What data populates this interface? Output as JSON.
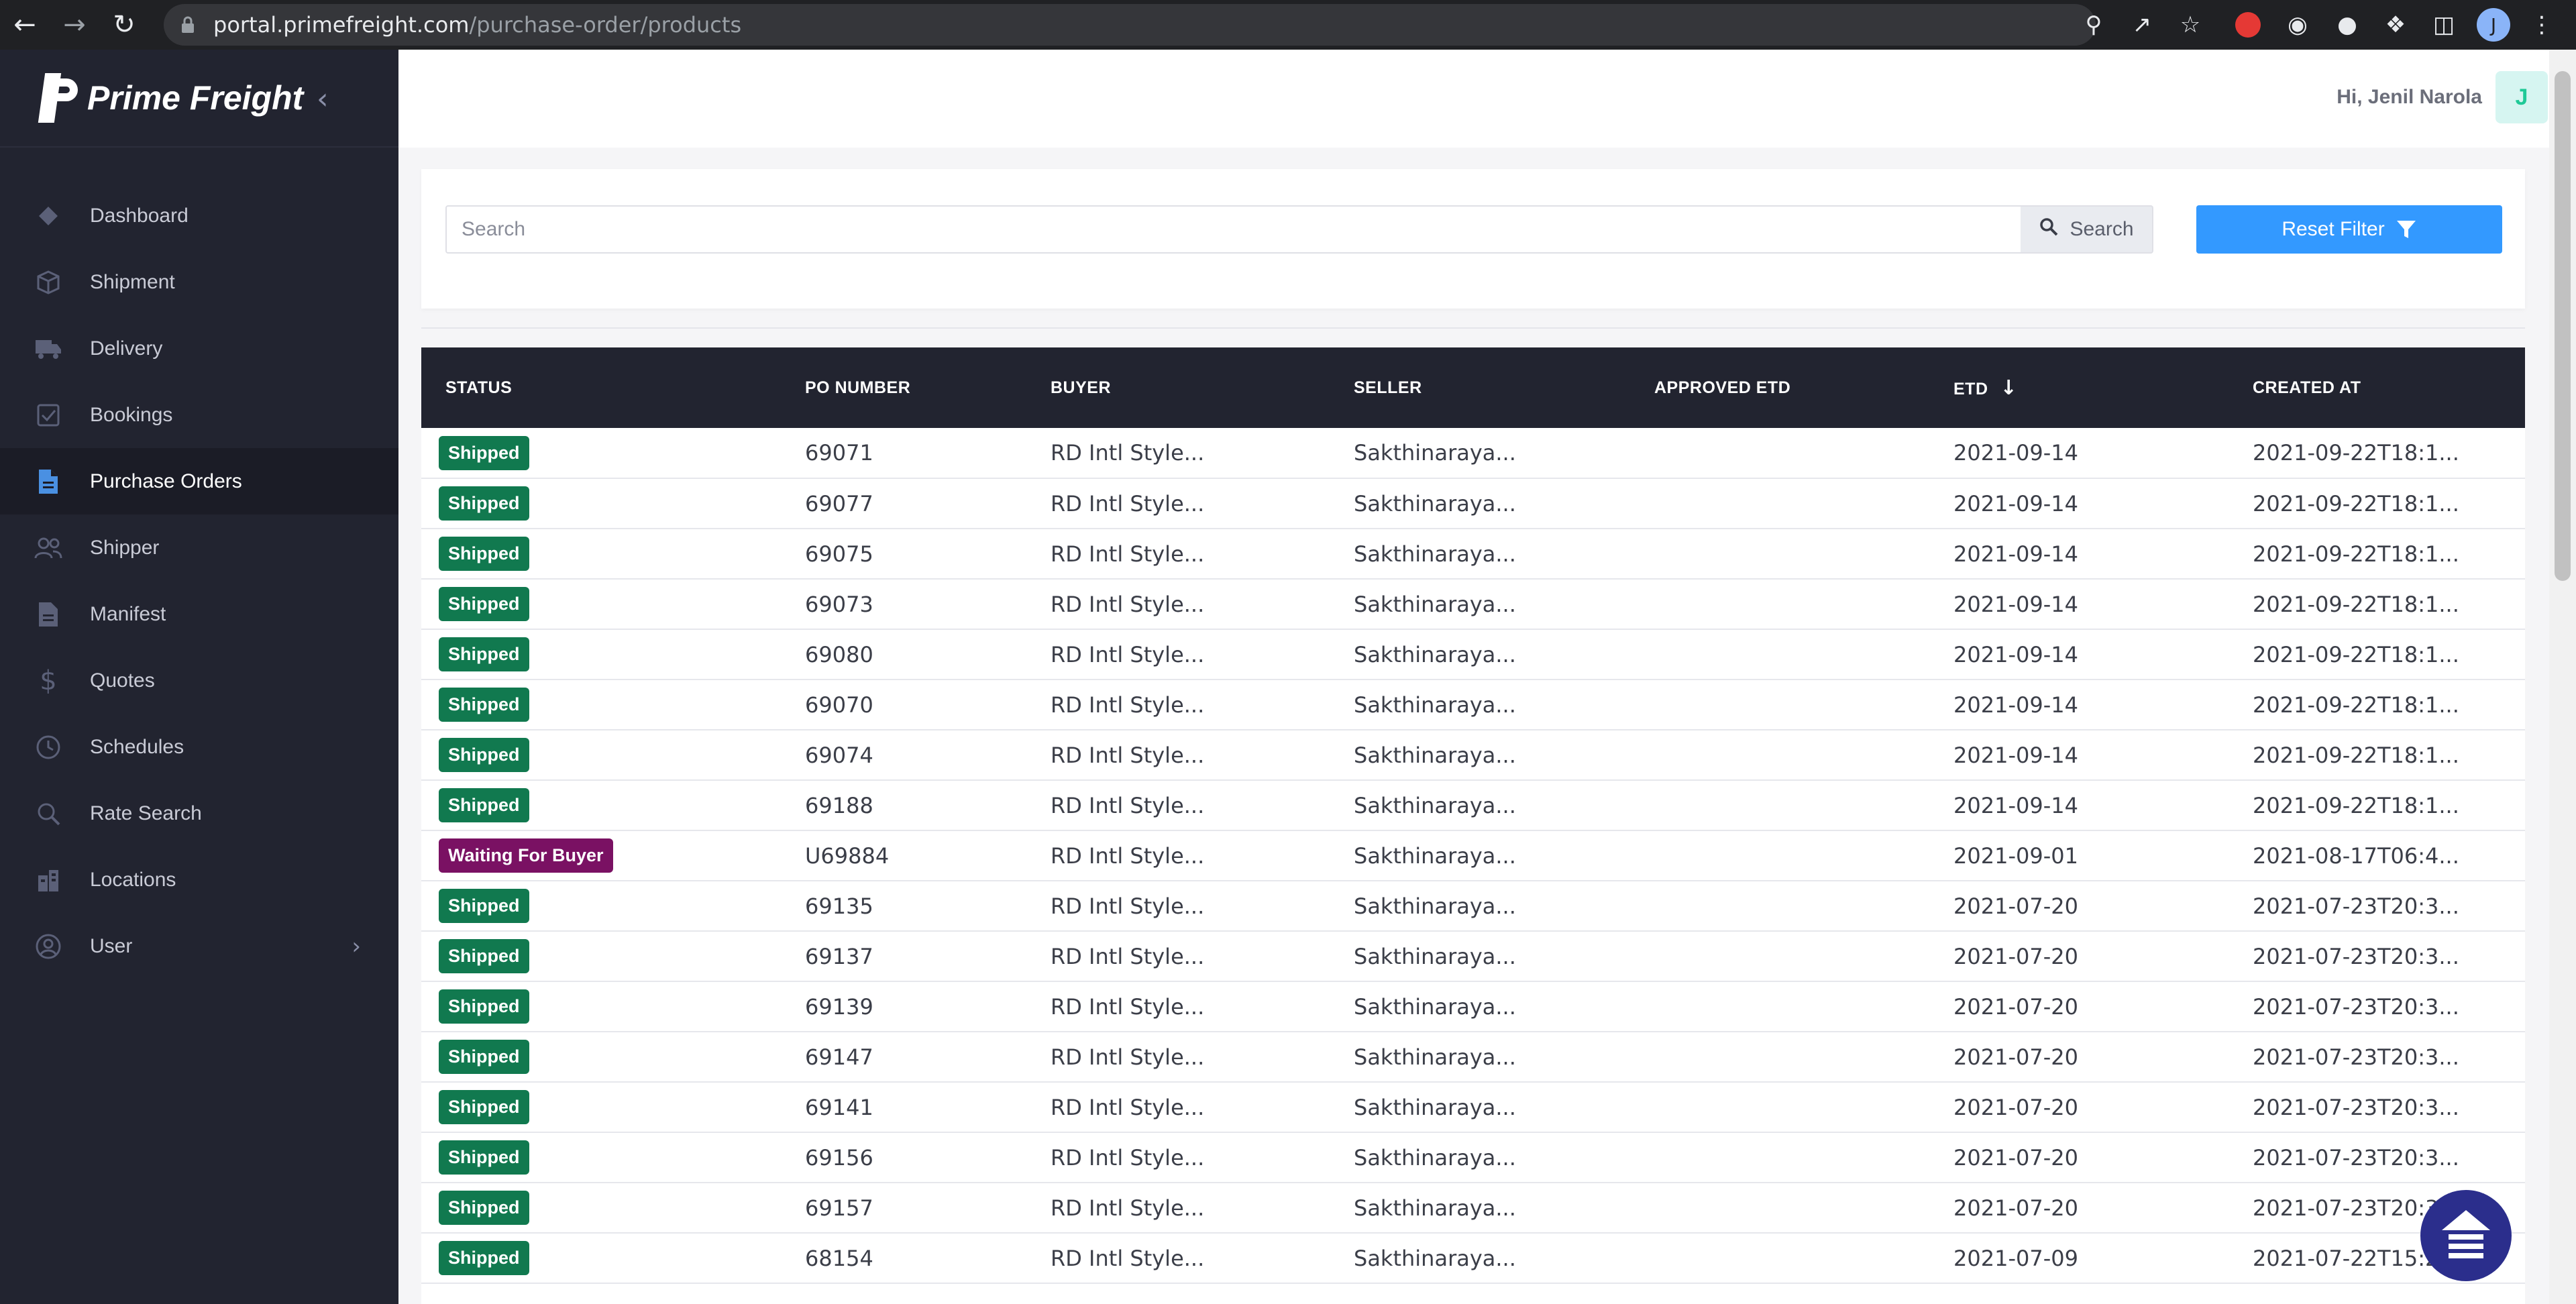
{
  "browser": {
    "url_host": "portal.primefreight.com",
    "url_path": "/purchase-order/products",
    "profile_initial": "J"
  },
  "sidebar": {
    "logo_text": "Prime Freight",
    "items": [
      {
        "label": "Dashboard",
        "icon": "diamond-icon"
      },
      {
        "label": "Shipment",
        "icon": "box-icon"
      },
      {
        "label": "Delivery",
        "icon": "truck-icon"
      },
      {
        "label": "Bookings",
        "icon": "checkbox-icon"
      },
      {
        "label": "Purchase Orders",
        "icon": "file-icon",
        "active": true
      },
      {
        "label": "Shipper",
        "icon": "users-icon"
      },
      {
        "label": "Manifest",
        "icon": "document-icon"
      },
      {
        "label": "Quotes",
        "icon": "dollar-icon"
      },
      {
        "label": "Schedules",
        "icon": "clock-icon"
      },
      {
        "label": "Rate Search",
        "icon": "search-icon"
      },
      {
        "label": "Locations",
        "icon": "building-icon"
      },
      {
        "label": "User",
        "icon": "user-circle-icon",
        "has_submenu": true
      }
    ]
  },
  "header": {
    "greeting": "Hi, Jenil Narola",
    "avatar_initial": "J"
  },
  "search": {
    "placeholder": "Search",
    "button_label": "Search",
    "reset_label": "Reset Filter"
  },
  "table": {
    "columns": [
      "STATUS",
      "PO NUMBER",
      "BUYER",
      "SELLER",
      "APPROVED ETD",
      "ETD",
      "CREATED AT"
    ],
    "sorted_column": "ETD",
    "rows": [
      {
        "status": "Shipped",
        "po": "69071",
        "buyer": "RD Intl Style...",
        "seller": "Sakthinaraya...",
        "approved_etd": "",
        "etd": "2021-09-14",
        "created": "2021-09-22T18:1..."
      },
      {
        "status": "Shipped",
        "po": "69077",
        "buyer": "RD Intl Style...",
        "seller": "Sakthinaraya...",
        "approved_etd": "",
        "etd": "2021-09-14",
        "created": "2021-09-22T18:1..."
      },
      {
        "status": "Shipped",
        "po": "69075",
        "buyer": "RD Intl Style...",
        "seller": "Sakthinaraya...",
        "approved_etd": "",
        "etd": "2021-09-14",
        "created": "2021-09-22T18:1..."
      },
      {
        "status": "Shipped",
        "po": "69073",
        "buyer": "RD Intl Style...",
        "seller": "Sakthinaraya...",
        "approved_etd": "",
        "etd": "2021-09-14",
        "created": "2021-09-22T18:1..."
      },
      {
        "status": "Shipped",
        "po": "69080",
        "buyer": "RD Intl Style...",
        "seller": "Sakthinaraya...",
        "approved_etd": "",
        "etd": "2021-09-14",
        "created": "2021-09-22T18:1..."
      },
      {
        "status": "Shipped",
        "po": "69070",
        "buyer": "RD Intl Style...",
        "seller": "Sakthinaraya...",
        "approved_etd": "",
        "etd": "2021-09-14",
        "created": "2021-09-22T18:1..."
      },
      {
        "status": "Shipped",
        "po": "69074",
        "buyer": "RD Intl Style...",
        "seller": "Sakthinaraya...",
        "approved_etd": "",
        "etd": "2021-09-14",
        "created": "2021-09-22T18:1..."
      },
      {
        "status": "Shipped",
        "po": "69188",
        "buyer": "RD Intl Style...",
        "seller": "Sakthinaraya...",
        "approved_etd": "",
        "etd": "2021-09-14",
        "created": "2021-09-22T18:1..."
      },
      {
        "status": "Waiting For Buyer",
        "po": "U69884",
        "buyer": "RD Intl Style...",
        "seller": "Sakthinaraya...",
        "approved_etd": "",
        "etd": "2021-09-01",
        "created": "2021-08-17T06:4..."
      },
      {
        "status": "Shipped",
        "po": "69135",
        "buyer": "RD Intl Style...",
        "seller": "Sakthinaraya...",
        "approved_etd": "",
        "etd": "2021-07-20",
        "created": "2021-07-23T20:3..."
      },
      {
        "status": "Shipped",
        "po": "69137",
        "buyer": "RD Intl Style...",
        "seller": "Sakthinaraya...",
        "approved_etd": "",
        "etd": "2021-07-20",
        "created": "2021-07-23T20:3..."
      },
      {
        "status": "Shipped",
        "po": "69139",
        "buyer": "RD Intl Style...",
        "seller": "Sakthinaraya...",
        "approved_etd": "",
        "etd": "2021-07-20",
        "created": "2021-07-23T20:3..."
      },
      {
        "status": "Shipped",
        "po": "69147",
        "buyer": "RD Intl Style...",
        "seller": "Sakthinaraya...",
        "approved_etd": "",
        "etd": "2021-07-20",
        "created": "2021-07-23T20:3..."
      },
      {
        "status": "Shipped",
        "po": "69141",
        "buyer": "RD Intl Style...",
        "seller": "Sakthinaraya...",
        "approved_etd": "",
        "etd": "2021-07-20",
        "created": "2021-07-23T20:3..."
      },
      {
        "status": "Shipped",
        "po": "69156",
        "buyer": "RD Intl Style...",
        "seller": "Sakthinaraya...",
        "approved_etd": "",
        "etd": "2021-07-20",
        "created": "2021-07-23T20:3..."
      },
      {
        "status": "Shipped",
        "po": "69157",
        "buyer": "RD Intl Style...",
        "seller": "Sakthinaraya...",
        "approved_etd": "",
        "etd": "2021-07-20",
        "created": "2021-07-23T20:3..."
      },
      {
        "status": "Shipped",
        "po": "68154",
        "buyer": "RD Intl Style...",
        "seller": "Sakthinaraya...",
        "approved_etd": "",
        "etd": "2021-07-09",
        "created": "2021-07-22T15:2..."
      }
    ]
  },
  "colors": {
    "sidebar_bg": "#222430",
    "accent": "#3399ff",
    "shipped": "#11794f",
    "waiting": "#7a1163"
  }
}
